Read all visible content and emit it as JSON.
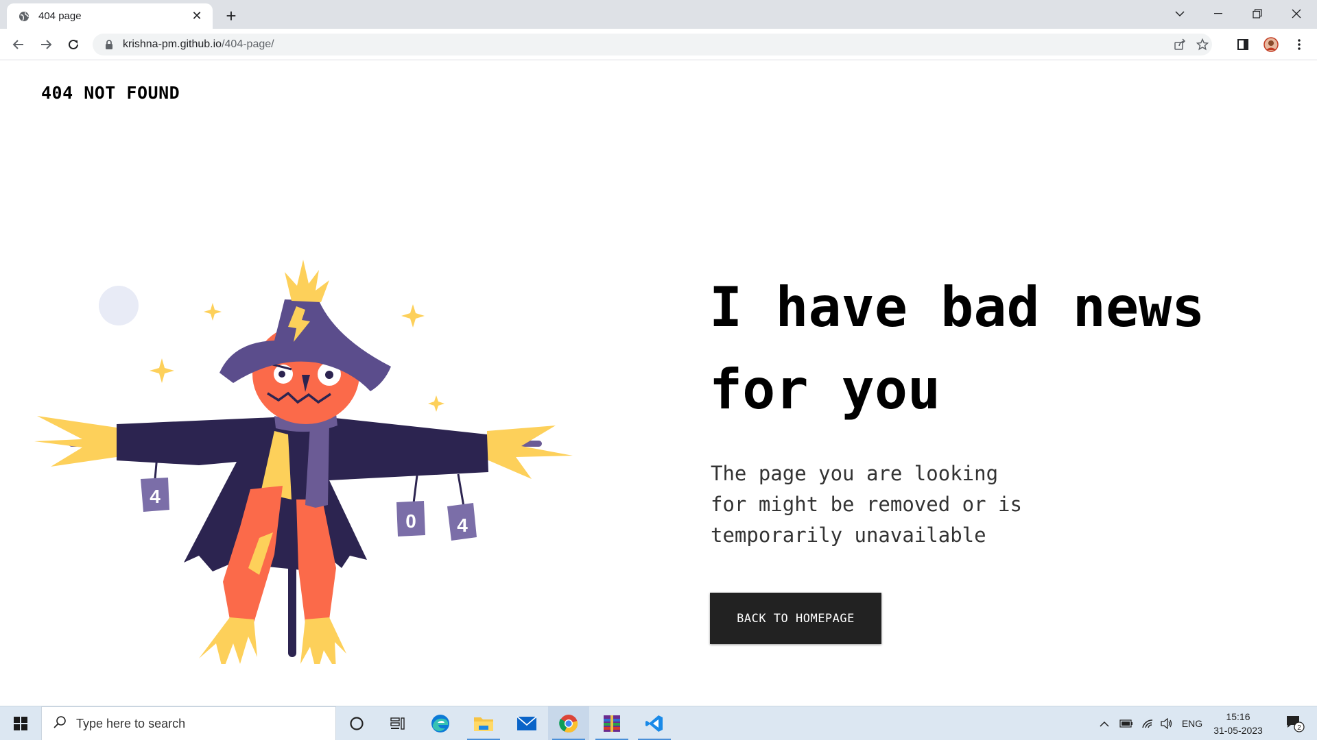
{
  "browser": {
    "tab_title": "404 page",
    "url_host": "krishna-pm.github.io",
    "url_path": "/404-page/"
  },
  "page": {
    "brand": "404 NOT FOUND",
    "headline_line1": "I have bad news",
    "headline_line2": "for you",
    "sub_line1": "The page you are looking",
    "sub_line2": "for might be removed or is",
    "sub_line3": "temporarily unavailable",
    "cta_label": "BACK TO HOMEPAGE",
    "can_labels": [
      "4",
      "0",
      "4"
    ]
  },
  "taskbar": {
    "search_placeholder": "Type here to search",
    "lang": "ENG",
    "time": "15:16",
    "date": "31-05-2023",
    "notification_count": "2"
  },
  "colors": {
    "hat": "#5b4d8c",
    "coat": "#2c2450",
    "face": "#fb6a4a",
    "straw": "#fdd05a",
    "scarf": "#6b5b95",
    "button_bg": "#222222"
  },
  "icons": [
    "globe-icon",
    "close-icon",
    "plus-icon",
    "back-icon",
    "forward-icon",
    "reload-icon",
    "lock-icon",
    "share-icon",
    "star-icon",
    "sidepanel-icon",
    "profile-icon",
    "menu-icon",
    "windows-icon",
    "search-icon",
    "cortana-icon",
    "taskview-icon",
    "edge-icon",
    "explorer-icon",
    "mail-icon",
    "chrome-icon",
    "winrar-icon",
    "vscode-icon",
    "chevron-up-icon",
    "battery-icon",
    "wifi-icon",
    "volume-icon",
    "notification-icon"
  ]
}
